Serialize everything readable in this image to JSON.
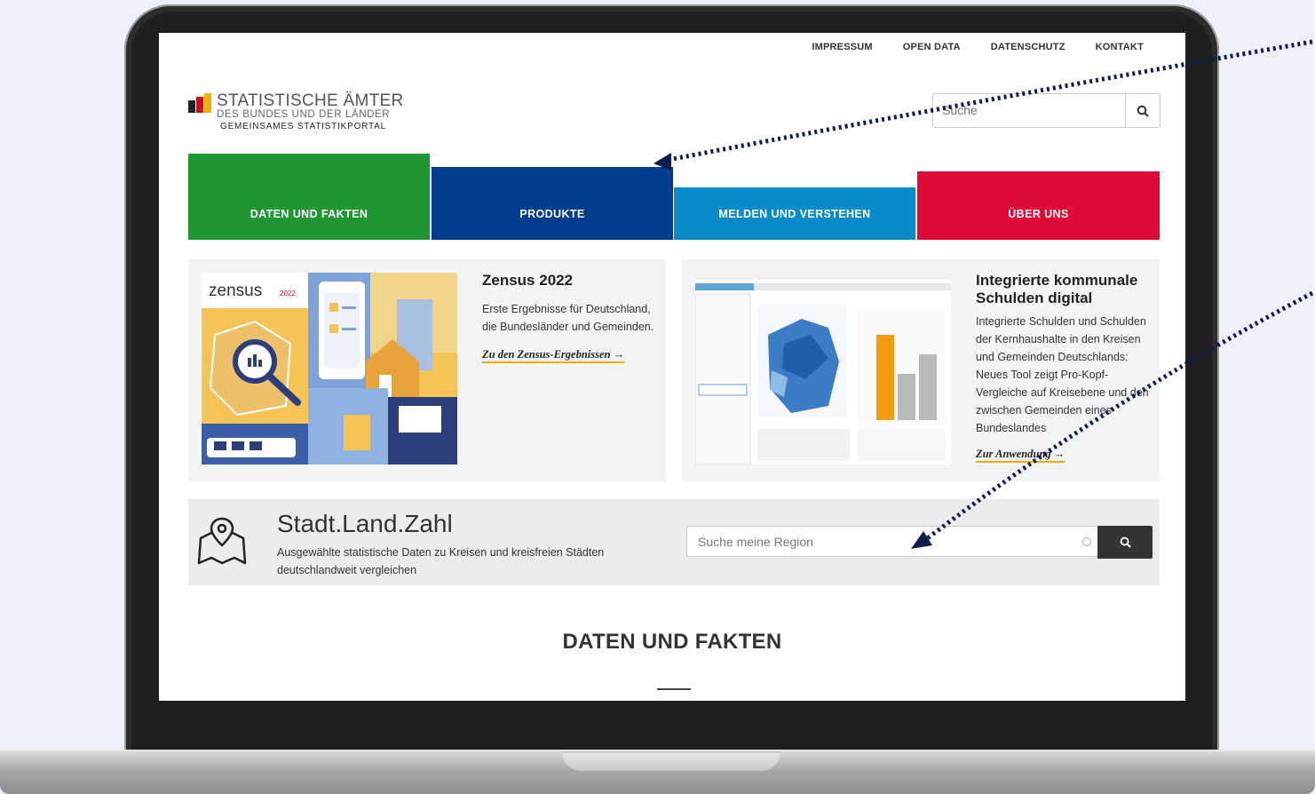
{
  "top_links": [
    "IMPRESSUM",
    "OPEN DATA",
    "DATENSCHUTZ",
    "KONTAKT"
  ],
  "logo": {
    "line1": "STATISTISCHE ÄMTER",
    "line2": "DES BUNDES UND DER LÄNDER",
    "line3": "GEMEINSAMES STATISTIKPORTAL"
  },
  "search": {
    "placeholder": "Suche"
  },
  "nav": [
    {
      "label": "DATEN UND FAKTEN",
      "color": "#1e9632"
    },
    {
      "label": "PRODUKTE",
      "color": "#003d8f"
    },
    {
      "label": "MELDEN UND VERSTEHEN",
      "color": "#0a8bc9"
    },
    {
      "label": "ÜBER UNS",
      "color": "#df0a37"
    }
  ],
  "card_zensus": {
    "image_logo": "zensus",
    "image_logo_year": "2022",
    "title": "Zensus 2022",
    "text": "Erste Ergebnisse für Deutsch­land, die Bundesländer und Ge­meinden.",
    "link": "Zu den Zensus-Ergebnissen"
  },
  "card_schulden": {
    "title": "Integrierte kommunale Schulden digital",
    "text": "Integrierte Schulden und Schul­den der Kernhaushalte in den Kreisen und Gemeinden Deutschlands: Neues Tool zeigt Pro-Kopf-Vergleiche auf Kreis­ebene und den zwischen Ge­meinden eines Bundeslandes",
    "link": "Zur Anwendung"
  },
  "stadt_land_zahl": {
    "title": "Stadt.Land.Zahl",
    "subtitle": "Ausgewählte statistische Daten zu Kreisen und kreisfreien Städten deutschlandweit vergleichen",
    "search_placeholder": "Suche meine Region"
  },
  "section_heading": "DATEN UND FAKTEN",
  "colors": {
    "accent_link_underline": "#f5a800",
    "annotation_arrow": "#0d1e4a"
  }
}
